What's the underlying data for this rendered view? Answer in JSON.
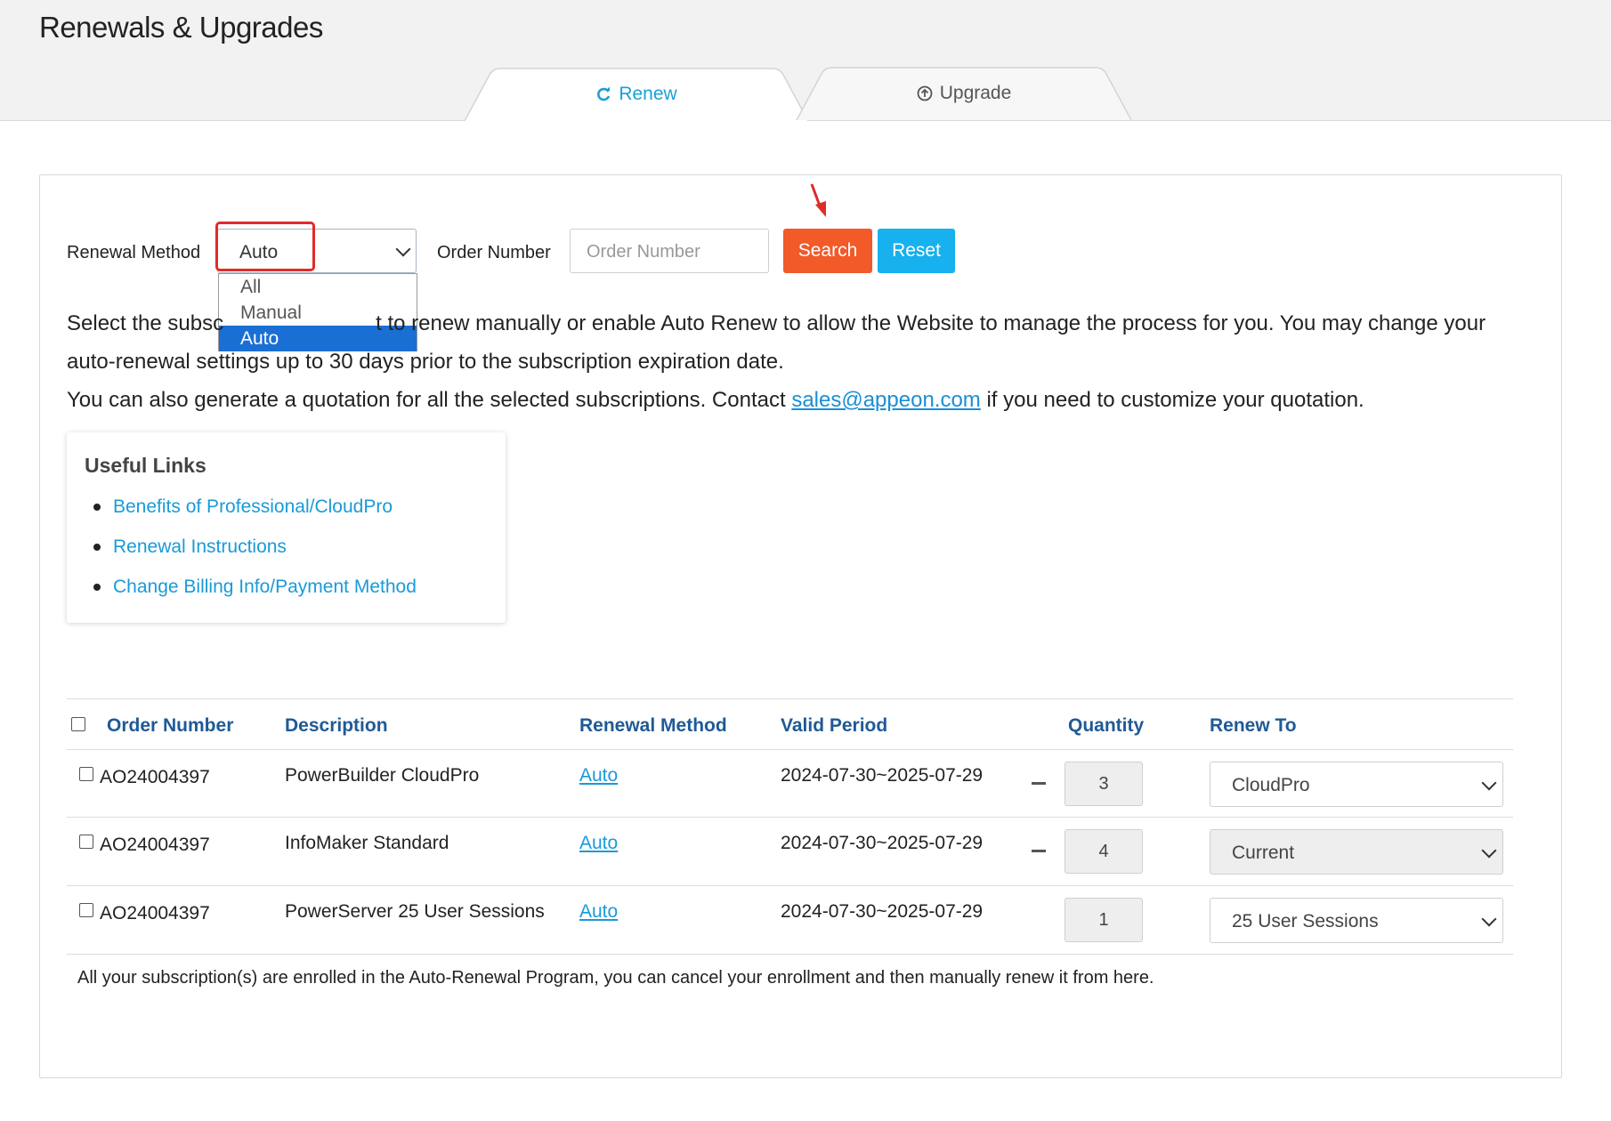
{
  "page": {
    "title": "Renewals & Upgrades"
  },
  "tabs": [
    {
      "label": "Renew",
      "icon": "refresh-icon",
      "active": true
    },
    {
      "label": "Upgrade",
      "icon": "circle-arrow-up-icon",
      "active": false
    }
  ],
  "filters": {
    "renewal_method_label": "Renewal Method",
    "renewal_method_value": "Auto",
    "renewal_method_options": [
      "All",
      "Manual",
      "Auto"
    ],
    "order_number_label": "Order Number",
    "order_number_placeholder": "Order Number",
    "search_label": "Search",
    "reset_label": "Reset"
  },
  "intro": {
    "line1_pre": "Select the subsc",
    "line1_post": "t to renew manually or enable Auto Renew to allow the Website to manage the process for you. You may change your",
    "line2": "auto-renewal settings up to 30 days prior to the subscription expiration date.",
    "line3_pre": "You can also generate a quotation for all the selected subscriptions. Contact ",
    "line3_email": "sales@appeon.com",
    "line3_post": " if you need to customize your quotation."
  },
  "useful_links": {
    "title": "Useful Links",
    "items": [
      "Benefits of Professional/CloudPro",
      "Renewal Instructions",
      "Change Billing Info/Payment Method"
    ]
  },
  "table": {
    "headers": [
      "Order Number",
      "Description",
      "Renewal Method",
      "Valid Period",
      "Quantity",
      "Renew To"
    ],
    "rows": [
      {
        "order": "AO24004397",
        "description": "PowerBuilder CloudPro",
        "method": "Auto",
        "period": "2024-07-30~2025-07-29",
        "quantity": "3",
        "renew_to": "CloudPro"
      },
      {
        "order": "AO24004397",
        "description": "InfoMaker Standard",
        "method": "Auto",
        "period": "2024-07-30~2025-07-29",
        "quantity": "4",
        "renew_to": "Current"
      },
      {
        "order": "AO24004397",
        "description": "PowerServer 25 User Sessions",
        "method": "Auto",
        "period": "2024-07-30~2025-07-29",
        "quantity": "1",
        "renew_to": "25 User Sessions"
      }
    ]
  },
  "footnote": "All your subscription(s) are enrolled in the Auto-Renewal Program, you can cancel your enrollment and then manually renew it from here.",
  "colors": {
    "accent": "#1aa0d8",
    "search": "#f25a2a",
    "reset": "#16b1ee",
    "header_text": "#1f5a96",
    "highlight": "#e02b2b",
    "selected_option": "#1a6fd4"
  }
}
